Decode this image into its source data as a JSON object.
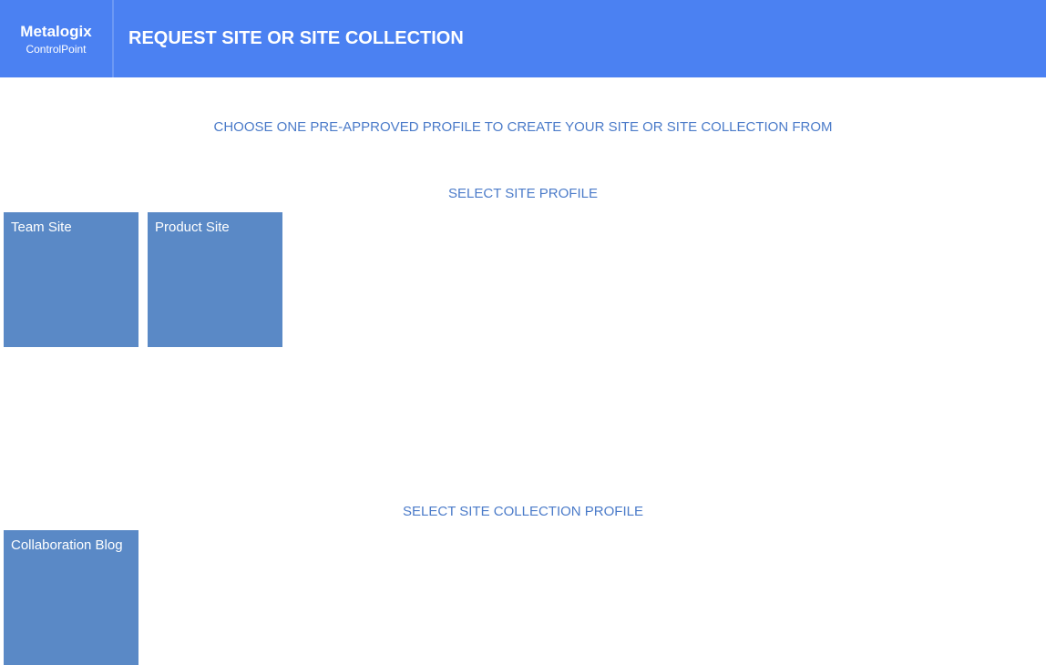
{
  "logo": {
    "title": "Metalogix",
    "subtitle": "ControlPoint"
  },
  "header": {
    "title": "REQUEST SITE OR SITE COLLECTION"
  },
  "instruction": "CHOOSE ONE PRE-APPROVED PROFILE TO CREATE YOUR SITE OR SITE COLLECTION FROM",
  "sections": {
    "siteProfile": {
      "heading": "SELECT SITE PROFILE",
      "tiles": [
        {
          "label": "Team Site"
        },
        {
          "label": "Product Site"
        }
      ]
    },
    "siteCollectionProfile": {
      "heading": "SELECT SITE COLLECTION PROFILE",
      "tiles": [
        {
          "label": "Collaboration Blog"
        }
      ]
    }
  }
}
